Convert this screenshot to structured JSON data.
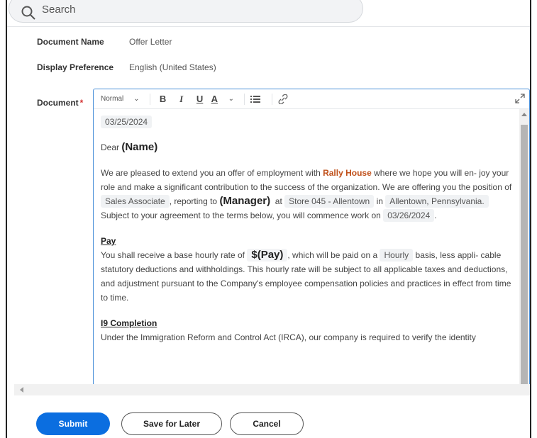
{
  "search": {
    "placeholder": "Search"
  },
  "fields": {
    "document_name_label": "Document Name",
    "document_name_value": "Offer Letter",
    "display_pref_label": "Display Preference",
    "display_pref_value": "English (United States)",
    "document_label": "Document"
  },
  "toolbar": {
    "style": "Normal",
    "bold": "B",
    "italic": "I",
    "underline": "U",
    "color": "A"
  },
  "letter": {
    "date": "03/25/2024",
    "dear": "Dear",
    "name": "(Name)",
    "p1_a": "We are pleased to extend you an offer of employment with",
    "company": "Rally House",
    "p1_b": "where we hope you will en- joy your role and make a significant contribution to the success of the organization. We are offering you the position of",
    "position": "Sales Associate",
    "p1_c": ", reporting to",
    "manager": "(Manager)",
    "p1_d": "at",
    "store": "Store 045 - Allentown",
    "p1_e": "in",
    "location": "Allentown, Pennsylvania.",
    "p1_f": "Subject to your agreement to the terms below, you will commence work on",
    "start_date": "03/26/2024",
    "p1_g": ".",
    "pay_heading": "Pay",
    "p2_a": "You shall receive a base hourly rate of",
    "pay_amount": "$(Pay)",
    "p2_b": ", which will be paid on a",
    "pay_basis": "Hourly",
    "p2_c": "basis, less appli- cable statutory deductions and withholdings. This hourly rate will be subject to all applicable taxes and deductions, and adjustment pursuant to the Company's employee compensation policies and practices in effect from time to time.",
    "i9_heading": "I9 Completion",
    "p3": "Under the Immigration Reform and Control Act (IRCA), our company is required to verify the identity"
  },
  "buttons": {
    "submit": "Submit",
    "save": "Save for Later",
    "cancel": "Cancel"
  },
  "colors": {
    "accent": "#0b6ee0",
    "brand": "#c0501a",
    "required": "#d32f2f"
  }
}
